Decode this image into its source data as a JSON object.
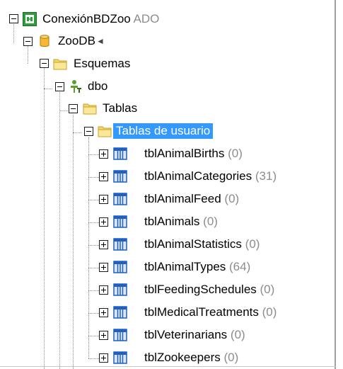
{
  "tree": {
    "connection": {
      "label": "ConexiónBDZoo",
      "type_tag": "ADO",
      "icon": "connection-icon"
    },
    "database": {
      "label": "ZooDB",
      "icon": "database-icon",
      "active_marker": "◄"
    },
    "schemas_folder": {
      "label": "Esquemas",
      "icon": "folder-icon"
    },
    "schema": {
      "label": "dbo",
      "icon": "schema-user-icon"
    },
    "tables_folder": {
      "label": "Tablas",
      "icon": "folder-icon"
    },
    "user_tables_folder": {
      "label": "Tablas de usuario",
      "icon": "folder-icon",
      "selected": true
    },
    "tables": [
      {
        "name": "tblAnimalBirths",
        "count": "(0)"
      },
      {
        "name": "tblAnimalCategories",
        "count": "(31)"
      },
      {
        "name": "tblAnimalFeed",
        "count": "(0)"
      },
      {
        "name": "tblAnimals",
        "count": "(0)"
      },
      {
        "name": "tblAnimalStatistics",
        "count": "(0)"
      },
      {
        "name": "tblAnimalTypes",
        "count": "(64)"
      },
      {
        "name": "tblFeedingSchedules",
        "count": "(0)"
      },
      {
        "name": "tblMedicalTreatments",
        "count": "(0)"
      },
      {
        "name": "tblVeterinarians",
        "count": "(0)"
      },
      {
        "name": "tblZookeepers",
        "count": "(0)"
      }
    ]
  },
  "colors": {
    "selection": "#3399ff",
    "count_text": "#8c8c8c",
    "folder": "#f5d76e",
    "table_icon": "#1f5fbf",
    "connection": "#2e9e3c"
  }
}
